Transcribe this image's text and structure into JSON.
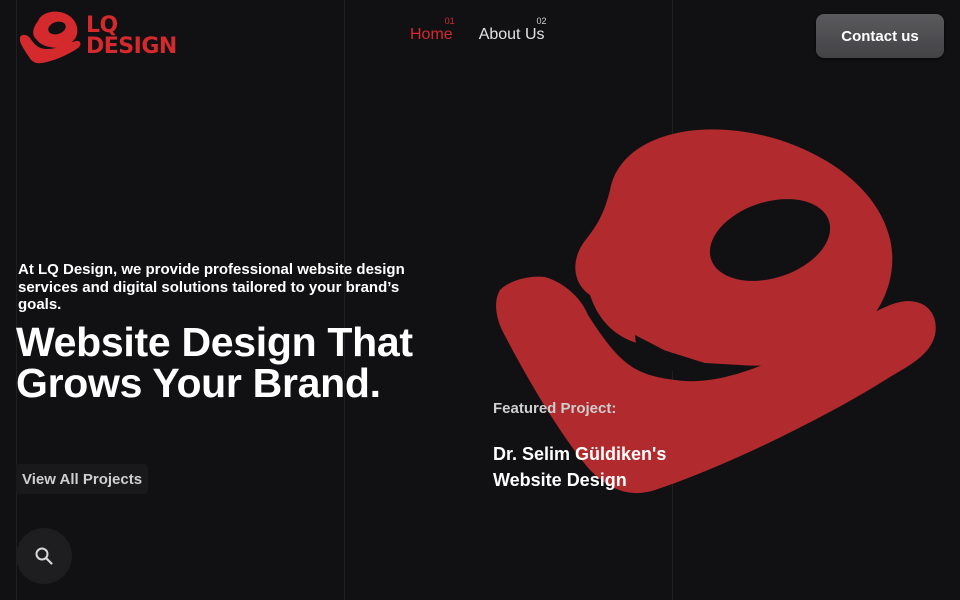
{
  "brand": {
    "name_line1": "LQ",
    "name_line2": "DESIGN",
    "accent_color": "#d42a2e"
  },
  "nav": {
    "items": [
      {
        "number": "01",
        "label": "Home",
        "active": true
      },
      {
        "number": "02",
        "label": "About Us",
        "active": false
      }
    ]
  },
  "header": {
    "contact_label": "Contact us"
  },
  "hero": {
    "intro": "At LQ Design, we provide professional website design services and digital solutions tailored to your brand’s goals.",
    "headline": "Website Design That Grows Your Brand.",
    "view_all_label": "View All Projects"
  },
  "featured": {
    "label": "Featured Project:",
    "title": "Dr. Selim Güldiken's Website Design"
  },
  "icons": {
    "search": "search-icon",
    "logo": "lq-logo-mark"
  }
}
